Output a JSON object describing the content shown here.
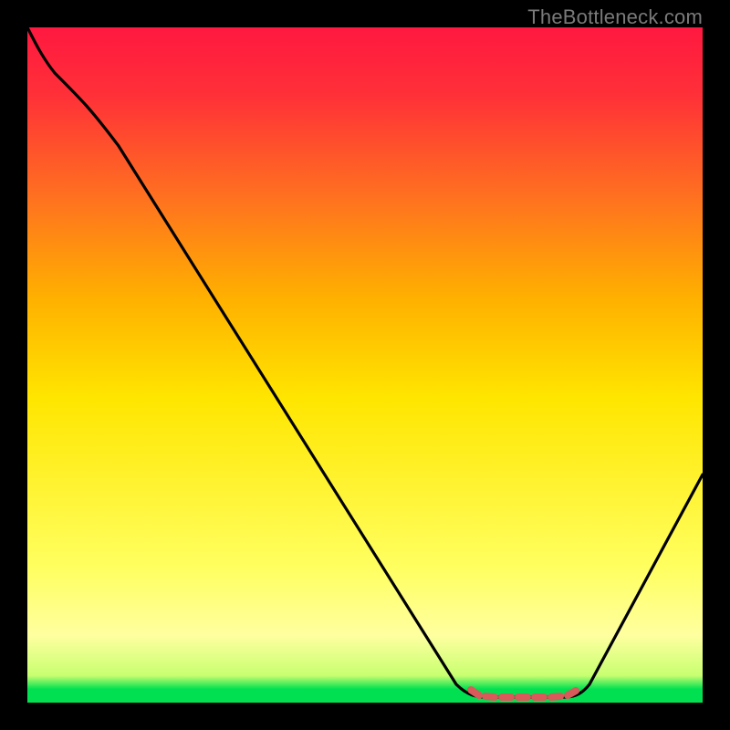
{
  "watermark": {
    "text": "TheBottleneck.com"
  },
  "colors": {
    "top_red": "#ff1840",
    "mid_yellow": "#ffe600",
    "pale_yellow": "#ffffa0",
    "green": "#00e050",
    "black": "#000000",
    "marker": "#d85a5a",
    "curve": "#000000"
  },
  "chart_data": {
    "type": "line",
    "title": "",
    "xlabel": "",
    "ylabel": "",
    "xlim": [
      0,
      100
    ],
    "ylim": [
      0,
      100
    ],
    "note": "Axis values are approximate percentages inferred from pixel positions (no axis ticks shown).",
    "series": [
      {
        "name": "bottleneck-curve",
        "x": [
          0,
          2,
          5,
          10,
          20,
          30,
          40,
          50,
          60,
          64,
          68,
          72,
          76,
          80,
          84,
          88,
          92,
          96,
          100
        ],
        "y": [
          100,
          98,
          94.5,
          88,
          75,
          62,
          49,
          36,
          22,
          14,
          7,
          3,
          1,
          0.5,
          1.5,
          6,
          14,
          24,
          34
        ]
      }
    ],
    "annotations": {
      "flat_band": {
        "name": "optimal-range-marker",
        "color": "#d85a5a",
        "x_range": [
          66,
          80
        ],
        "y": 1
      }
    },
    "background_gradient": {
      "type": "vertical",
      "stops": [
        {
          "offset": 0.0,
          "color": "#ff1840"
        },
        {
          "offset": 0.5,
          "color": "#ffe600"
        },
        {
          "offset": 0.9,
          "color": "#ffffa0"
        },
        {
          "offset": 0.97,
          "color": "#00e050"
        },
        {
          "offset": 1.0,
          "color": "#00e050"
        }
      ]
    }
  }
}
